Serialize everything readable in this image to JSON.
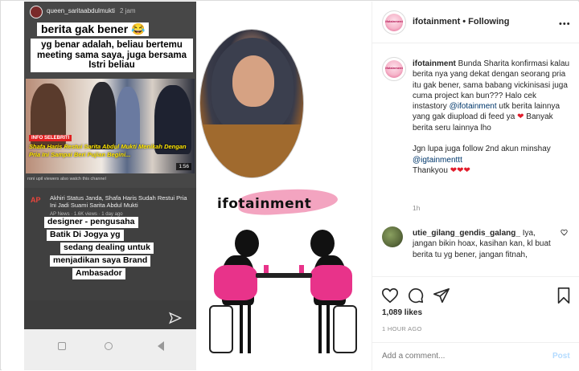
{
  "media": {
    "story_user": "queen_saritaabdulmukti",
    "story_time": "2 jam",
    "caption_line1": "berita gak bener 😂",
    "caption_line2": "yg benar adalah, beliau bertemu meeting sama saya, juga bersama Istri beliau",
    "news_tag": "INFO SELEBRITI",
    "news_headline": "Shafa Haris Restui Sarita Abdul Mukti Menikah Dengan Pria Ini Sampai Beri Pujian Begini...",
    "news_duration": "1:56",
    "roni_text": "roni upil viewers also watch this channel",
    "ap_logo": "AP",
    "ap_title": "Akhiri Status Janda, Shafa Haris Sudah Restui Pria Ini Jadi Suami Sarita Abdul Mukti",
    "ap_meta": "AP News · 1.6K views · 1 day ago",
    "caption_line3": "designer - pengusaha",
    "caption_line4": "Batik Di Jogya yg",
    "caption_line5": "sedang dealing untuk",
    "caption_line6": "menjadikan saya Brand",
    "caption_line7": "Ambasador",
    "logo_text": "ifotainment"
  },
  "header": {
    "username": "ifotainment",
    "separator": "•",
    "follow_label": "Following",
    "more_label": "•••"
  },
  "avatar_text": "ifotainment",
  "post": {
    "username": "ifotainment",
    "text_part1": " Bunda Sharita konfirmasi kalau berita nya yang dekat dengan seorang pria itu gak bener, sama babang vickinisasi juga cuma project kan bun??? Halo cek instastory ",
    "mention1": "@ifotainment",
    "text_part2": " utk berita lainnya yang gak diupload di feed ya ",
    "heart1": "❤",
    "text_part3": " Banyak berita seru lainnya lho",
    "text_part4": "Jgn lupa juga follow 2nd akun minshay",
    "mention2": "@igtainmenttt",
    "text_part5": "Thankyou ",
    "hearts": "❤❤❤",
    "age": "1h"
  },
  "comment": {
    "username": "utie_gilang_gendis_galang_",
    "text": " Iya, jangan bikin hoax, kasihan kan, kl buat berita tu yg bener, jangan fitnah,"
  },
  "actions": {
    "likes": "1,089 likes",
    "time_ago": "1 HOUR AGO",
    "comment_placeholder": "Add a comment...",
    "post_label": "Post"
  },
  "icons": {
    "like": "heart-icon",
    "comment": "comment-icon",
    "share": "share-icon",
    "save": "bookmark-icon",
    "more": "more-options-icon"
  },
  "colors": {
    "heart_red": "#e21d2c",
    "mention_blue": "#00376b",
    "post_button_disabled": "#b3dbff",
    "muted_text": "#8e8e8e"
  }
}
